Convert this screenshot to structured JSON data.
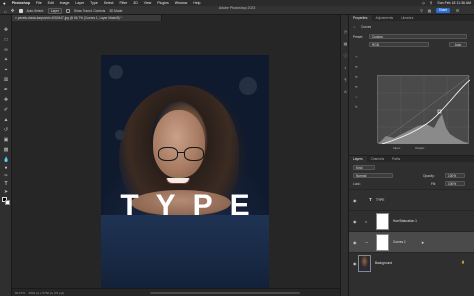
{
  "menubar": {
    "apple": "",
    "app": "Photoshop",
    "items": [
      "File",
      "Edit",
      "Image",
      "Layer",
      "Type",
      "Select",
      "Filter",
      "3D",
      "View",
      "Plugins",
      "Window",
      "Help"
    ],
    "clock": "Sun Feb 18  11:36 AM"
  },
  "options": {
    "window_title": "Adobe Photoshop 2023",
    "auto_select_label": "Auto-Select:",
    "layer_select": "Layer",
    "transform_label": "Show Transf. Controls",
    "mode_3d": "3D Mode:",
    "share_label": "Share"
  },
  "document": {
    "tab_title": "×  pexels-vlada-karpovich-4050447.jpg @ 66.7% (Curves 1, Layer Mask/8) *"
  },
  "canvas": {
    "headline": "TYPE"
  },
  "status": {
    "zoom": "66.67%",
    "info": "3840 px x 5760 px (72 ppi)"
  },
  "properties": {
    "tabs": [
      "Properties",
      "Adjustments",
      "Libraries"
    ],
    "panel_name": "Curves",
    "preset_label": "Preset:",
    "preset_value": "Custom",
    "channel_value": "RGB",
    "auto_label": "Auto",
    "input_label": "Input:",
    "output_label": "Output:"
  },
  "layers": {
    "tabs": [
      "Layers",
      "Channels",
      "Paths"
    ],
    "kind_label": "Kind",
    "blend_mode": "Normal",
    "opacity_label": "Opacity:",
    "opacity_value": "100%",
    "lock_label": "Lock:",
    "fill_label": "Fill:",
    "fill_value": "100%",
    "items": [
      {
        "name": "TYPE",
        "kind": "text"
      },
      {
        "name": "Hue/Saturation 1",
        "kind": "adjustment"
      },
      {
        "name": "Curves 1",
        "kind": "adjustment",
        "selected": true
      },
      {
        "name": "Background",
        "kind": "photo"
      }
    ]
  },
  "colors": {
    "accent": "#2d6fd6",
    "panel_bg": "#2f2f2f",
    "workspace_bg": "#262626"
  }
}
